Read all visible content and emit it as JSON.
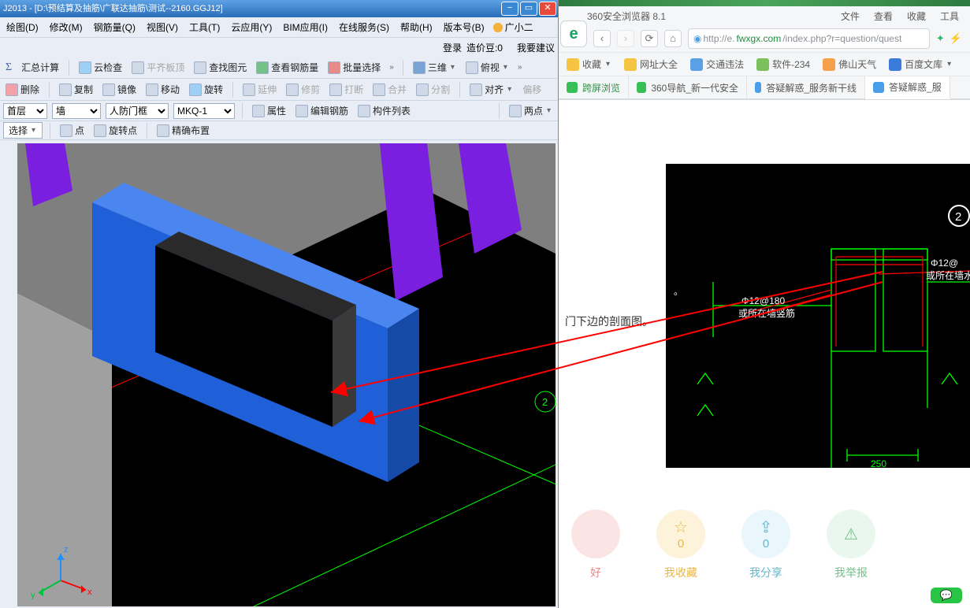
{
  "left": {
    "title": "J2013 - [D:\\预结算及抽筋\\广联达抽筋\\测试--2160.GGJ12]",
    "menus": [
      "绘图(D)",
      "修改(M)",
      "钢筋量(Q)",
      "视图(V)",
      "工具(T)",
      "云应用(Y)",
      "BIM应用(I)",
      "在线服务(S)",
      "帮助(H)",
      "版本号(B)"
    ],
    "guangxiao": "广小二",
    "login": "登录",
    "price": "造价豆:0",
    "suggest": "我要建议",
    "row1": {
      "sum": "汇总计算",
      "cloud": "云检查",
      "flat": "平齐板顶",
      "find": "查找图元",
      "steel": "查看钢筋量",
      "batch": "批量选择",
      "view3d": "三维",
      "top": "俯视"
    },
    "row2": {
      "del": "删除",
      "copy": "复制",
      "mirror": "镜像",
      "move": "移动",
      "rotate": "旋转",
      "extend": "延伸",
      "trim": "修剪",
      "break": "打断",
      "merge": "合并",
      "split": "分割",
      "align": "对齐",
      "offset": "偏移"
    },
    "row3": {
      "floor": "首层",
      "cat": "墙",
      "member": "人防门框",
      "code": "MKQ-1",
      "prop": "属性",
      "editrebar": "编辑钢筋",
      "list": "构件列表",
      "two": "两点"
    },
    "row4": {
      "select": "选择",
      "point": "点",
      "rotpoint": "旋转点",
      "accurate": "精确布置"
    }
  },
  "browser": {
    "name": "360安全浏览器 8.1",
    "topmenu": [
      "文件",
      "查看",
      "收藏",
      "工具"
    ],
    "url_plain": "http://e.",
    "url_domain": "fwxgx.com",
    "url_tail": "/index.php?r=question/quest",
    "bookmarks": {
      "fav": "收藏",
      "wz": "网址大全",
      "jt": "交通违法",
      "rj": "软件-234",
      "tq": "佛山天气",
      "bd": "百度文库"
    },
    "tabs": {
      "t1": "跨屏浏览",
      "t2": "360导航_新一代安全",
      "t3": "答疑解惑_服务新干线",
      "t4": "答疑解惑_服"
    },
    "page": {
      "note": "门下边的剖面图。",
      "cad_labels": {
        "a": "Φ12@180",
        "b": "或所在墙竖筋",
        "c": "Φ12@",
        "d": "或所在墙水平",
        "dim": "250"
      },
      "good": "好",
      "fav": "我收藏",
      "share": "我分享",
      "rep": "我举报",
      "fav_n": "0",
      "share_n": "0"
    }
  }
}
